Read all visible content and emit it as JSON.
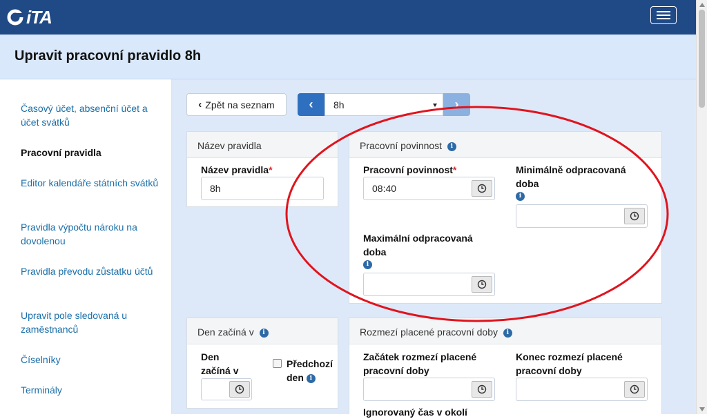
{
  "header": {
    "logo_text": "iTA",
    "menu_icon": "hamburger-icon"
  },
  "page": {
    "title": "Upravit pracovní pravidlo 8h"
  },
  "sidebar": {
    "items": [
      {
        "label": "Časový účet, absenční účet a účet svátků",
        "active": false
      },
      {
        "label": "Pracovní pravidla",
        "active": true
      },
      {
        "label": "Editor kalendáře státních svátků",
        "active": false
      },
      {
        "label": "Pravidla výpočtu nároku na dovolenou",
        "active": false
      },
      {
        "label": "Pravidla převodu zůstatku účtů",
        "active": false
      },
      {
        "label": "Upravit pole sledovaná u zaměstnanců",
        "active": false
      },
      {
        "label": "Číselníky",
        "active": false
      },
      {
        "label": "Terminály",
        "active": false
      }
    ]
  },
  "toolbar": {
    "back_label": "Zpět na seznam",
    "selected_rule": "8h"
  },
  "panels": {
    "name": {
      "title": "Název pravidla",
      "field_label": "Název pravidla",
      "required_mark": "*",
      "field_value": "8h"
    },
    "obligation": {
      "title": "Pracovní povinnost",
      "obligation_label": "Pracovní povinnost",
      "required_mark": "*",
      "obligation_value": "08:40",
      "min_label_1": "Minimálně odpracovaná",
      "min_label_2": "doba",
      "min_value": "",
      "max_label_1": "Maximální odpracovaná",
      "max_label_2": "doba",
      "max_value": ""
    },
    "day_start": {
      "title": "Den začíná v",
      "label_1": "Den",
      "label_2": "začíná v",
      "value": "",
      "prev_day_label_1": "Předchozí",
      "prev_day_label_2": "den",
      "prev_day_checked": false
    },
    "paid_range": {
      "title": "Rozmezí placené pracovní doby",
      "start_label_1": "Začátek rozmezí placené",
      "start_label_2": "pracovní doby",
      "start_value": "",
      "end_label_1": "Konec rozmezí placené",
      "end_label_2": "pracovní doby",
      "end_value": "",
      "ignored_label": "Ignorovaný čas v okolí"
    }
  },
  "annotation": {
    "color": "#e0141e"
  },
  "colors": {
    "header_bg": "#1f4a86",
    "title_bg": "#d9e8fb",
    "main_bg": "#dde9f8",
    "link": "#1a6fa8",
    "primary": "#2f6fbf"
  }
}
